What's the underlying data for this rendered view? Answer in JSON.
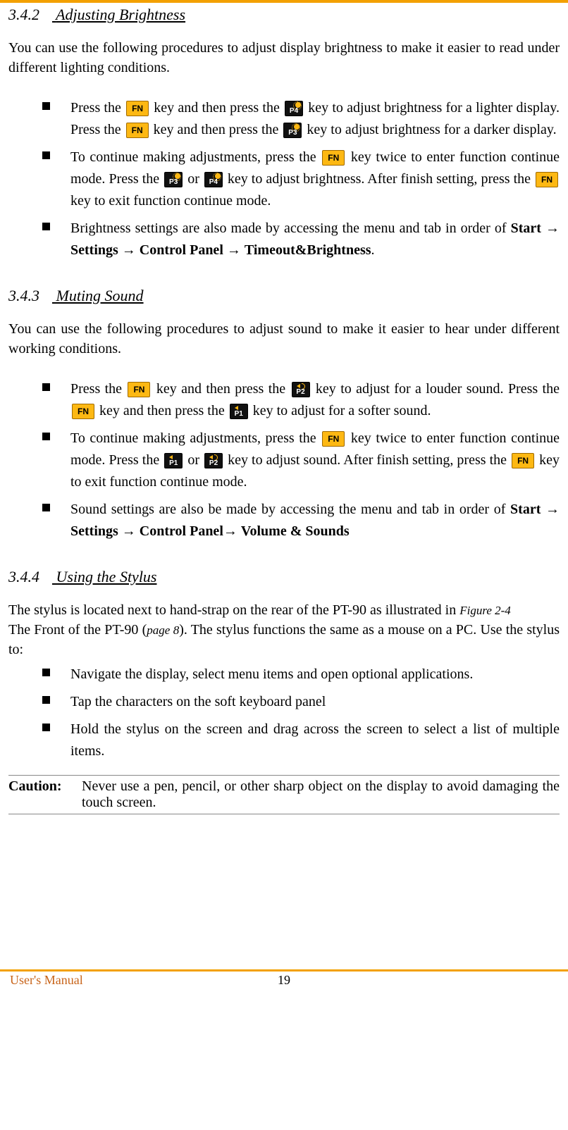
{
  "sections": {
    "brightness": {
      "num": "3.4.2",
      "title": "Adjusting Brightness",
      "intro": "You can use the following procedures to adjust display brightness to make it easier to read under different lighting conditions.",
      "b1a": "Press the ",
      "b1b": " key and then press the ",
      "b1c": " key to adjust brightness for a lighter display. Press the ",
      "b1d": " key and then press the ",
      "b1e": " key to adjust brightness for a darker display.",
      "b2a": "To continue making adjustments, press the ",
      "b2b": " key twice to enter function continue mode. Press the ",
      "b2c": " or ",
      "b2d": " key to adjust brightness. After finish setting, press the ",
      "b2e": " key to exit function continue mode.",
      "b3a": "Brightness settings are also made by accessing the menu and tab in order of ",
      "b3_start": "Start",
      "b3_settings": "Settings",
      "b3_cp": "Control Panel",
      "b3_tb": "Timeout&Brightness",
      "b3_period": "."
    },
    "sound": {
      "num": "3.4.3",
      "title": "Muting Sound",
      "intro": "You can use the following procedures to adjust sound to make it easier to hear under different working conditions.",
      "s1a": "Press the ",
      "s1b": " key and then press the ",
      "s1c": " key to adjust for a louder sound. Press the ",
      "s1d": " key and then press the ",
      "s1e": " key to adjust for a softer sound.",
      "s2a": "To continue making adjustments, press the ",
      "s2b": " key twice to enter function continue mode. Press the ",
      "s2c": " or ",
      "s2d": " key to adjust sound. After finish setting, press the ",
      "s2e": " key to exit function continue mode.",
      "s3a": "Sound settings are also be made by accessing the menu and tab in order of ",
      "s3_start": "Start",
      "s3_settings": "Settings",
      "s3_cp": "Control Panel",
      "s3_vs": "Volume & Sounds"
    },
    "stylus": {
      "num": "3.4.4",
      "title": "Using the Stylus",
      "p1a": "The stylus is located next to hand-strap on the rear of the PT-90 as illustrated in ",
      "p1_fig": "Figure 2-4",
      "p2a": "The Front of the PT-90 (",
      "p2_page": "page 8",
      "p2b": "). The stylus functions the same as a mouse on a PC. Use the stylus to:",
      "items": {
        "i1": "Navigate the display, select menu items and open optional applications.",
        "i2": "Tap the characters on the soft keyboard panel",
        "i3": "Hold the stylus on the screen and drag across the screen to select a list of multiple items."
      },
      "caution_label": "Caution:",
      "caution_text": "Never use a pen, pencil, or other sharp object on the display to avoid damaging the touch screen."
    }
  },
  "keys": {
    "fn": "FN",
    "p1": "P1",
    "p2": "P2",
    "p3": "P3",
    "p4": "P4"
  },
  "arrow": "→",
  "footer": {
    "left": "User's Manual",
    "page": "19"
  }
}
